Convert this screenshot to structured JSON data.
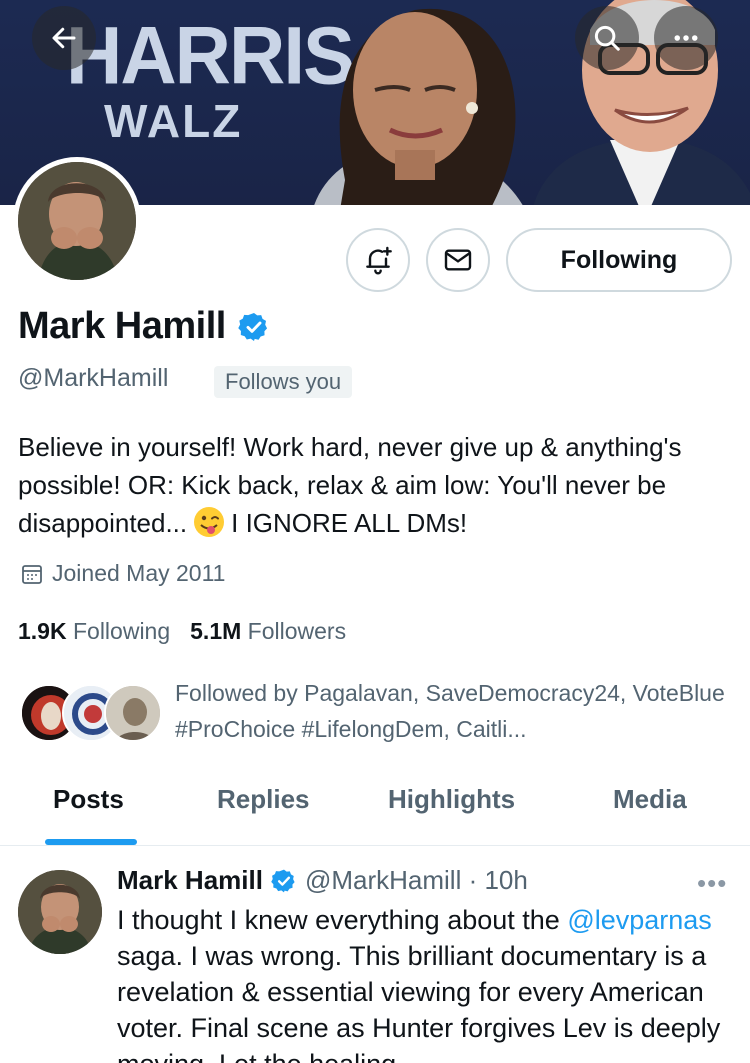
{
  "banner": {
    "line1": "HARRIS",
    "line2": "WALZ",
    "back_icon": "arrow-left-icon",
    "search_icon": "search-icon",
    "more_icon": "more-horizontal-icon"
  },
  "profile": {
    "name": "Mark Hamill",
    "handle": "@MarkHamill",
    "follows_you": "Follows you",
    "bio_part1": "Believe in yourself! Work hard, never give up & anything's possible! OR: Kick back, relax & aim low: You'll never be disappointed...",
    "bio_part2": "I IGNORE ALL DMs!",
    "joined": "Joined May 2011",
    "following_count": "1.9K",
    "following_label": "Following",
    "followers_count": "5.1M",
    "followers_label": "Followers",
    "followed_by": "Followed by Pagalavan, SaveDemocracy24, VoteBlue #ProChoice #LifelongDem, Caitli..."
  },
  "actions": {
    "notify_icon": "bell-plus-icon",
    "message_icon": "envelope-icon",
    "following_button": "Following"
  },
  "tabs": [
    "Posts",
    "Replies",
    "Highlights",
    "Media"
  ],
  "tweet": {
    "name": "Mark Hamill",
    "handle_time": "@MarkHamill · 10h",
    "more": "•••",
    "text_before": "I thought I knew everything about the ",
    "mention": "@levparnas",
    "text_after": " saga. I was wrong. This brilliant documentary is a revelation & essential viewing for every American voter. Final scene as Hunter forgives Lev is deeply moving. Let the healing"
  },
  "colors": {
    "accent": "#1d9bf0",
    "secondary_text": "#536471",
    "banner_bg": "#1c2a52"
  }
}
